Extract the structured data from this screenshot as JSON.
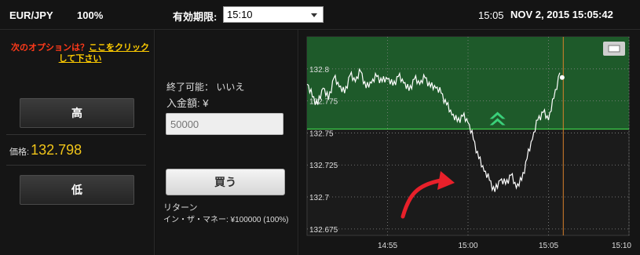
{
  "header": {
    "pair": "EUR/JPY",
    "payout": "100%",
    "expiry_label": "有効期限:",
    "expiry_value": "15:10",
    "current_time": "15:05",
    "datetime": "NOV 2, 2015 15:05:42"
  },
  "left_panel": {
    "next_option_text": "次のオプションは？",
    "next_option_link": "ここをクリックして下さい",
    "high_label": "高",
    "price_label": "価格:",
    "price_value": "132.798",
    "low_label": "低"
  },
  "middle_panel": {
    "available_text": "終了可能： いいえ",
    "amount_label": "入金額: ¥",
    "amount_placeholder": "50000",
    "buy_label": "買う",
    "return_label": "リターン",
    "return_value": "イン・ザ・マネー: ¥100000 (100%)"
  },
  "colors": {
    "in_the_money_zone": "#1e5a2a",
    "strike_line": "#3ecf4a",
    "price_line": "#ffffff",
    "expiry_line": "#d9822b",
    "arrow": "#e8202a",
    "up_indicator": "#3ad07a"
  },
  "chart_data": {
    "type": "line",
    "ylim": [
      132.67,
      132.825
    ],
    "xlim": [
      "14:50",
      "15:10"
    ],
    "yticks": [
      "132.8",
      "132.775",
      "132.75",
      "132.725",
      "132.7",
      "132.675"
    ],
    "xticks": [
      "14:55",
      "15:00",
      "15:05",
      "15:10"
    ],
    "strike": 132.753,
    "current_price": 132.798,
    "current_marker_time": "15:05:42",
    "entry_time": "15:00",
    "expiry_time": "15:05",
    "series": [
      {
        "x": [
          "14:50:00",
          "14:50:20",
          "14:50:40",
          "14:51:00",
          "14:51:20",
          "14:51:40",
          "14:52:00",
          "14:52:20",
          "14:52:40",
          "14:53:00",
          "14:53:20",
          "14:53:40",
          "14:54:00",
          "14:54:20",
          "14:54:40",
          "14:55:00",
          "14:55:20",
          "14:55:40",
          "14:56:00",
          "14:56:20",
          "14:56:40",
          "14:57:00",
          "14:57:20",
          "14:57:40",
          "14:58:00",
          "14:58:20",
          "14:58:40",
          "14:59:00",
          "14:59:20",
          "14:59:40",
          "15:00:00",
          "15:00:20",
          "15:00:40",
          "15:01:00",
          "15:01:20",
          "15:01:40",
          "15:02:00",
          "15:02:20",
          "15:02:40",
          "15:03:00",
          "15:03:20",
          "15:03:40",
          "15:04:00",
          "15:04:20",
          "15:04:40",
          "15:05:00",
          "15:05:20",
          "15:05:42"
        ],
        "y": [
          132.788,
          132.778,
          132.772,
          132.785,
          132.776,
          132.793,
          132.786,
          132.781,
          132.795,
          132.79,
          132.798,
          132.785,
          132.789,
          132.794,
          132.79,
          132.792,
          132.787,
          132.794,
          132.789,
          132.783,
          132.792,
          132.788,
          132.793,
          132.786,
          132.785,
          132.781,
          132.772,
          132.764,
          132.759,
          132.763,
          132.758,
          132.745,
          132.73,
          132.72,
          132.713,
          132.704,
          132.713,
          132.71,
          132.717,
          132.707,
          132.713,
          132.73,
          132.745,
          132.76,
          132.766,
          132.76,
          132.777,
          132.797
        ]
      }
    ]
  }
}
